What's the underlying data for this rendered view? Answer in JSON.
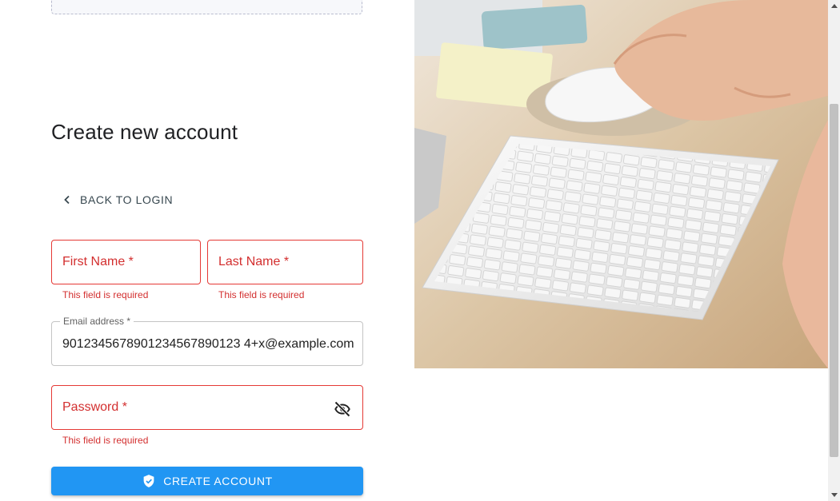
{
  "form": {
    "title": "Create new account",
    "back_link": "BACK TO LOGIN",
    "first_name": {
      "placeholder": "First Name *",
      "error": "This field is required"
    },
    "last_name": {
      "placeholder": "Last Name *",
      "error": "This field is required"
    },
    "email": {
      "label": "Email address *",
      "value": "9012345678901234567890123 4+x@example.com"
    },
    "password": {
      "placeholder": "Password *",
      "error": "This field is required"
    },
    "submit_label": "CREATE ACCOUNT"
  },
  "colors": {
    "accent": "#2196f3",
    "error": "#d32f2f"
  },
  "icons": {
    "back": "chevron-left-icon",
    "visibility": "eye-off-icon",
    "submit": "verified-shield-icon"
  }
}
